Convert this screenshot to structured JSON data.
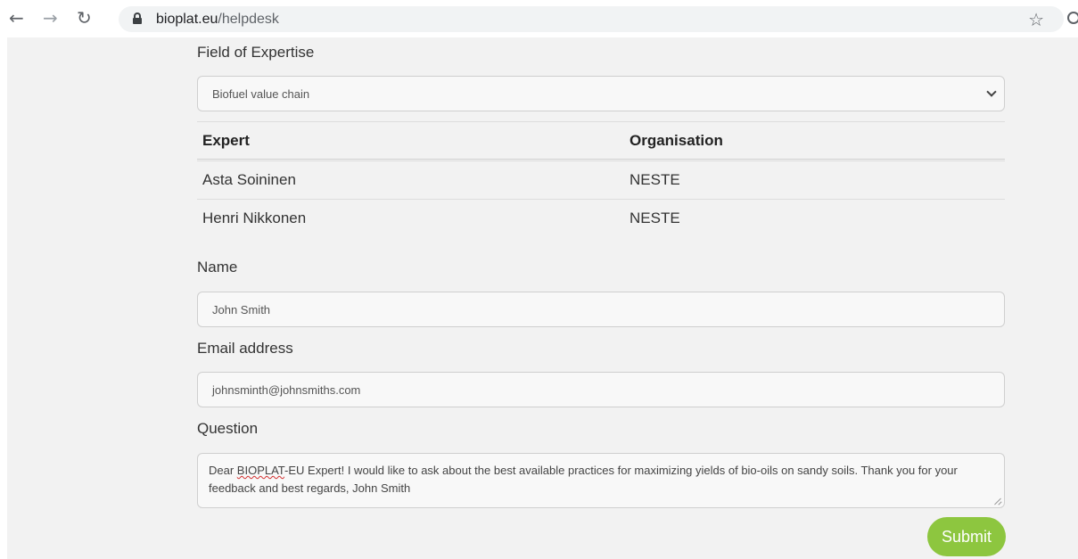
{
  "browser": {
    "url_host": "bioplat.eu",
    "url_path": "/helpdesk"
  },
  "form": {
    "expertise_label": "Field of Expertise",
    "expertise_value": "Biofuel value chain",
    "table": {
      "headers": [
        "Expert",
        "Organisation"
      ],
      "rows": [
        [
          "Asta Soininen",
          "NESTE"
        ],
        [
          "Henri Nikkonen",
          "NESTE"
        ]
      ]
    },
    "name_label": "Name",
    "name_value": "John Smith",
    "email_label": "Email address",
    "email_value": "johnsminth@johnsmiths.com",
    "question_label": "Question",
    "question_prefix": "Dear ",
    "question_misspelled": "BIOPLAT",
    "question_rest": "-EU Expert! I would like to ask about the best available practices for maximizing yields of bio-oils on sandy soils. Thank you for your feedback and best regards, John Smith",
    "submit_label": "Submit"
  },
  "colors": {
    "accent": "#8dc63f",
    "page_bg": "#f2f2f2"
  },
  "icons": [
    "back-arrow-icon",
    "forward-arrow-icon",
    "reload-icon",
    "lock-icon",
    "bookmark-star-icon",
    "extension-icon",
    "chevron-down-icon"
  ]
}
